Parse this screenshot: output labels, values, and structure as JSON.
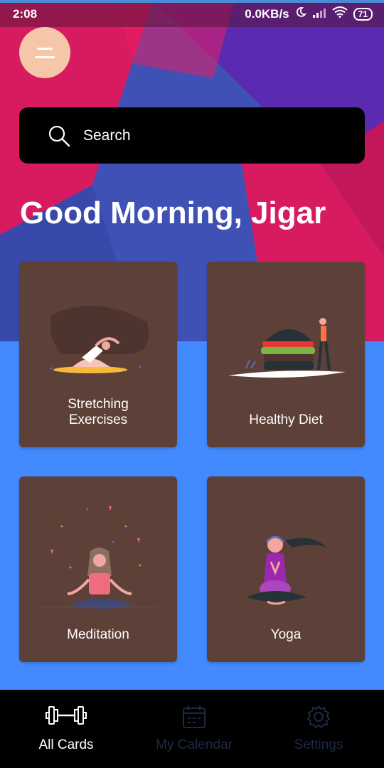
{
  "status_bar": {
    "time": "2:08",
    "network_speed": "0.0KB/s",
    "battery": "71",
    "icons": [
      "moon-icon",
      "signal-icon",
      "wifi-icon",
      "battery-icon"
    ]
  },
  "menu_button": {
    "icon": "menu-icon"
  },
  "search": {
    "placeholder": "Search",
    "icon": "search-icon"
  },
  "greeting": "Good Morning, Jigar",
  "cards": [
    {
      "label": "Stretching\nExercises",
      "line1": "Stretching",
      "line2": "Exercises",
      "illustration": "stretching-illustration"
    },
    {
      "label": "Healthy Diet",
      "illustration": "healthy-diet-illustration"
    },
    {
      "label": "Meditation",
      "illustration": "meditation-illustration"
    },
    {
      "label": "Yoga",
      "illustration": "yoga-illustration"
    }
  ],
  "bottom_nav": {
    "items": [
      {
        "label": "All Cards",
        "icon": "dumbbell-icon",
        "active": true
      },
      {
        "label": "My Calendar",
        "icon": "calendar-icon",
        "active": false
      },
      {
        "label": "Settings",
        "icon": "gear-icon",
        "active": false
      }
    ]
  },
  "colors": {
    "card_bg": "#5d4037",
    "bg_blue": "#448aff",
    "bg_pink": "#d81b60",
    "bg_purple": "#5a2bb0",
    "menu_btn": "#f5c6a8"
  }
}
